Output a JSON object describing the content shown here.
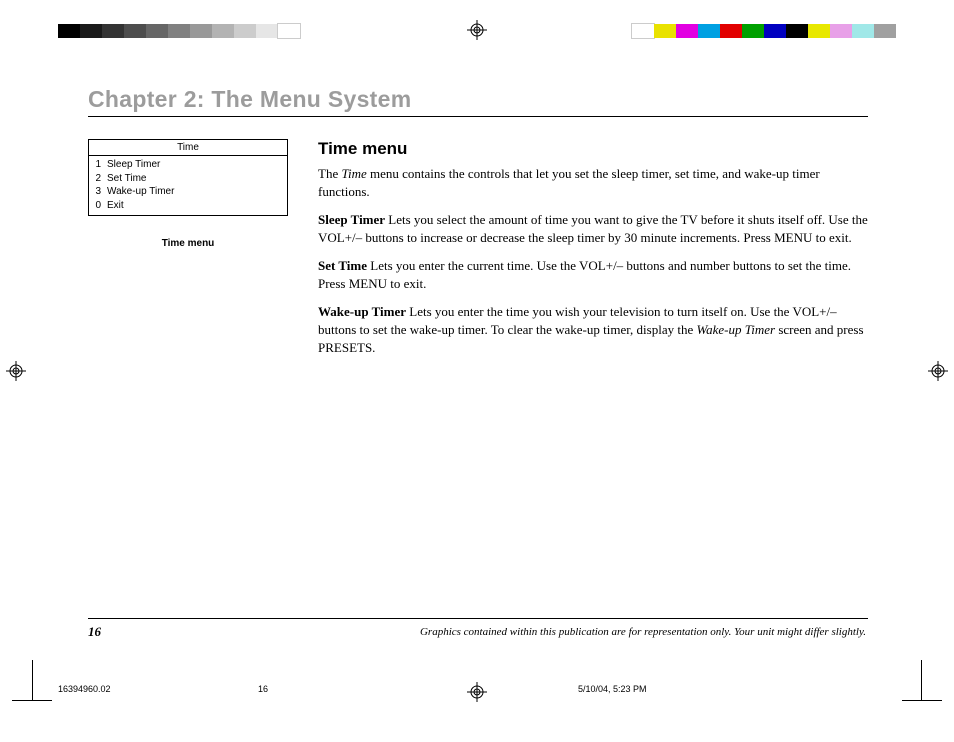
{
  "chapter_title": "Chapter 2: The Menu System",
  "menu_box": {
    "title": "Time",
    "items": [
      {
        "num": "1",
        "label": "Sleep Timer"
      },
      {
        "num": "2",
        "label": "Set Time"
      },
      {
        "num": "3",
        "label": "Wake-up Timer"
      },
      {
        "num": "0",
        "label": "Exit"
      }
    ],
    "caption": "Time menu"
  },
  "section": {
    "title": "Time menu",
    "intro_prefix": "The ",
    "intro_em": "Time",
    "intro_suffix": " menu contains the controls that let you set the sleep timer, set time, and wake-up timer functions.",
    "p2_lead": "Sleep Timer",
    "p2_body": "  Lets you select the amount of time you want to give the TV before it shuts itself off. Use the VOL+/– buttons to increase or decrease the sleep timer by 30 minute increments. Press MENU to exit.",
    "p3_lead": "Set Time",
    "p3_body": "  Lets you enter the current time. Use the VOL+/– buttons and number buttons to set the time. Press MENU to exit.",
    "p4_lead": "Wake-up Timer",
    "p4_body_a": "  Lets you enter the time you wish your television to turn itself on. Use the VOL+/– buttons to set the wake-up timer. To clear the wake-up timer, display the ",
    "p4_em": "Wake-up Timer",
    "p4_body_b": " screen and press PRESETS."
  },
  "footer": {
    "page_number": "16",
    "note": "Graphics contained within this publication are for representation only. Your unit might differ slightly."
  },
  "slug": {
    "doc_id": "16394960.02",
    "page": "16",
    "timestamp": "5/10/04, 5:23 PM"
  },
  "colorbars": {
    "left": [
      "#000000",
      "#1a1a1a",
      "#333333",
      "#4d4d4d",
      "#666666",
      "#808080",
      "#999999",
      "#b3b3b3",
      "#cccccc",
      "#e6e6e6",
      "#ffffff"
    ],
    "right": [
      "#ffffff",
      "#e9e200",
      "#e200e2",
      "#00a0e2",
      "#e20000",
      "#00a000",
      "#0000c0",
      "#000000",
      "#e8e800",
      "#e8a0e8",
      "#a0e8e8",
      "#a0a0a0"
    ]
  }
}
